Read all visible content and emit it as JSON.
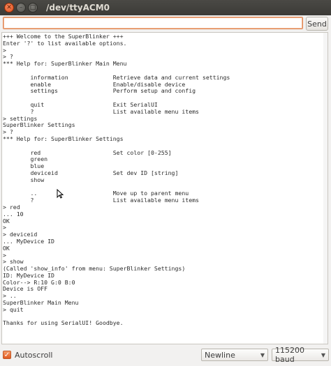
{
  "window": {
    "title": "/dev/ttyACM0"
  },
  "input": {
    "value": "",
    "send_label": "Send"
  },
  "console": {
    "text": "+++ Welcome to the SuperBlinker +++\nEnter '?' to list available options.\n>\n> ?\n*** Help for: SuperBlinker Main Menu\n\n\tinformation\t\tRetrieve data and current settings\n\tenable\t\t\tEnable/disable device\n\tsettings\t\tPerform setup and config\n\n\tquit\t\t\tExit SerialUI\n\t?\t\t\tList available menu items\n> settings\nSuperBlinker Settings\n> ?\n*** Help for: SuperBlinker Settings\n\n\tred\t\t\tSet color [0-255]\n\tgreen\n\tblue\n\tdeviceid\t\tSet dev ID [string]\n\tshow\n\n\t..\t\t\tMove up to parent menu\n\t?\t\t\tList available menu items\n> red\n... 10\nOK\n>\n> deviceid\n... MyDevice ID\nOK\n>\n> show\n(Called 'show_info' from menu: SuperBlinker Settings)\nID: MyDevice ID\nColor--> R:10 G:0 B:0\nDevice is OFF\n> ..\nSuperBlinker Main Menu\n> quit\n\nThanks for using SerialUI! Goodbye."
  },
  "footer": {
    "autoscroll_label": "Autoscroll",
    "autoscroll_checked": "✓",
    "line_ending": "Newline",
    "baud": "115200 baud"
  },
  "icons": {
    "close": "close-icon",
    "minimize": "minimize-icon",
    "maximize": "maximize-icon",
    "dropdown": "chevron-down-icon"
  },
  "colors": {
    "accent": "#e0591f",
    "titlebar": "#3c3b37"
  }
}
